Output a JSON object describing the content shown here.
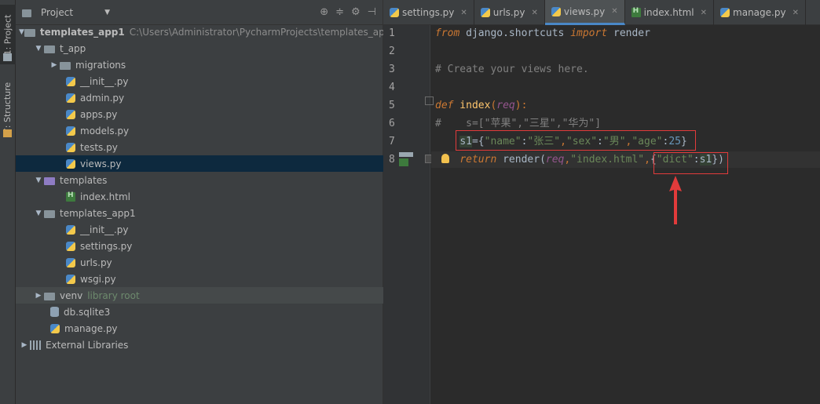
{
  "sidebar_tabs": [
    "1: Project",
    "7: Structure"
  ],
  "project_panel": {
    "title": "Project",
    "tree": [
      {
        "label": "templates_app1",
        "path": "C:\\Users\\Administrator\\PycharmProjects\\templates_app"
      },
      {
        "label": "t_app"
      },
      {
        "label": "migrations"
      },
      {
        "label": "__init__.py"
      },
      {
        "label": "admin.py"
      },
      {
        "label": "apps.py"
      },
      {
        "label": "models.py"
      },
      {
        "label": "tests.py"
      },
      {
        "label": "views.py"
      },
      {
        "label": "templates"
      },
      {
        "label": "index.html"
      },
      {
        "label": "templates_app1"
      },
      {
        "label": "__init__.py"
      },
      {
        "label": "settings.py"
      },
      {
        "label": "urls.py"
      },
      {
        "label": "wsgi.py"
      },
      {
        "label": "venv",
        "note": "library root"
      },
      {
        "label": "db.sqlite3"
      },
      {
        "label": "manage.py"
      },
      {
        "label": "External Libraries"
      }
    ]
  },
  "editor": {
    "tabs": [
      "settings.py",
      "urls.py",
      "views.py",
      "index.html",
      "manage.py"
    ],
    "active_tab": "views.py",
    "line_numbers": [
      "1",
      "2",
      "3",
      "4",
      "5",
      "6",
      "7",
      "8"
    ],
    "code": {
      "l1_from": "from",
      "l1_mod": " django.shortcuts ",
      "l1_import": "import",
      "l1_name": " render",
      "l3_comment": "# Create your views here.",
      "l5_def": "def",
      "l5_fn": " index",
      "l5_paren_open": "(",
      "l5_param": "req",
      "l5_tail": "):",
      "l6_comment": "#    s=[\"苹果\",\"三星\",\"华为\"]",
      "l7_indent": "    ",
      "l7_var": "s1",
      "l7_eq": "={",
      "l7_k1": "\"name\"",
      "l7_c1": ":",
      "l7_v1": "\"张三\"",
      "l7_s1": ",",
      "l7_k2": "\"sex\"",
      "l7_c2": ":",
      "l7_v2": "\"男\"",
      "l7_s2": ",",
      "l7_k3": "\"age\"",
      "l7_c3": ":",
      "l7_v3": "25",
      "l7_end": "}",
      "l8_indent": "    ",
      "l8_return": "return",
      "l8_render": " render(",
      "l8_req": "req",
      "l8_comma": ",",
      "l8_tpl": "\"index.html\"",
      "l8_comma2": ",",
      "l8_brace": "{",
      "l8_key": "\"dict\"",
      "l8_colon": ":",
      "l8_var": "s1",
      "l8_end": "})"
    }
  },
  "colors": {
    "annotation_red": "#e23b3b"
  }
}
